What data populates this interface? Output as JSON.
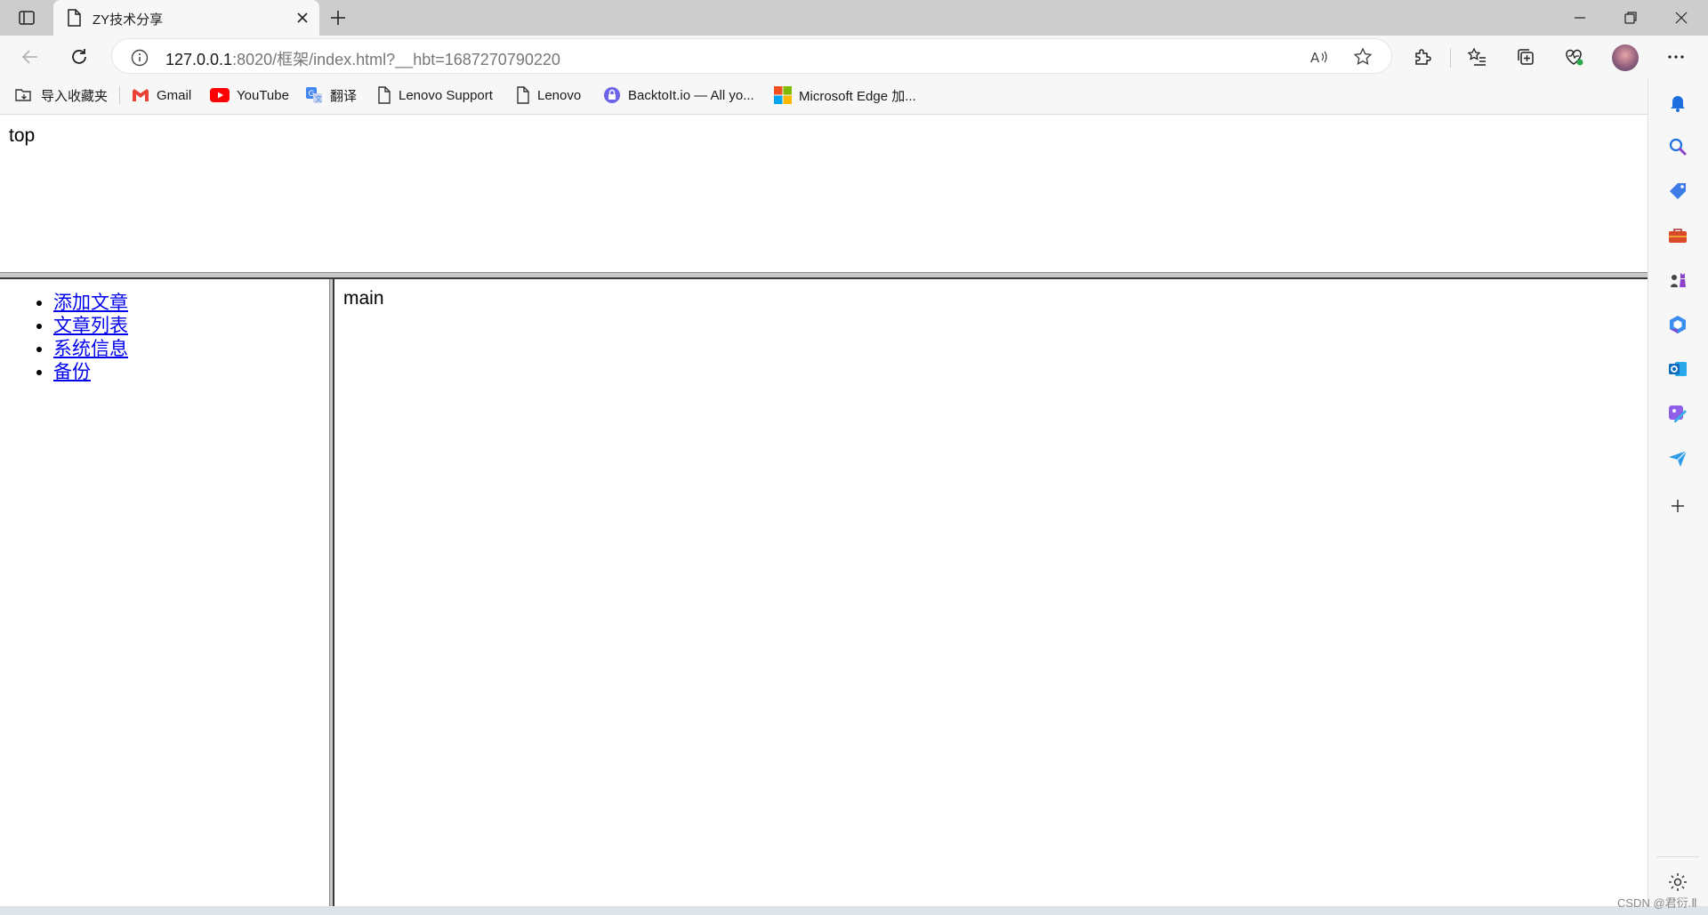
{
  "browser": {
    "tab_title": "ZY技术分享",
    "url_host": "127.0.0.1",
    "url_rest": ":8020/框架/index.html?__hbt=1687270790220"
  },
  "favorites": [
    {
      "label": "导入收藏夹",
      "icon": "import-favorites-icon"
    },
    {
      "label": "Gmail",
      "icon": "gmail-icon"
    },
    {
      "label": "YouTube",
      "icon": "youtube-icon"
    },
    {
      "label": "翻译",
      "icon": "translate-icon"
    },
    {
      "label": "Lenovo Support",
      "icon": "page-icon"
    },
    {
      "label": "Lenovo",
      "icon": "page-icon"
    },
    {
      "label": "BacktoIt.io — All yo...",
      "icon": "backtoit-icon"
    },
    {
      "label": "Microsoft Edge 加...",
      "icon": "microsoft-icon"
    }
  ],
  "page": {
    "top_text": "top",
    "main_text": "main",
    "nav_links": [
      "添加文章",
      "文章列表",
      "系统信息",
      "备份"
    ]
  },
  "watermark": "CSDN @君衍.Ⅱ",
  "colors": {
    "link": "#0000ee",
    "tabstrip": "#cdcdcd",
    "toolbar": "#f7f7f7"
  }
}
